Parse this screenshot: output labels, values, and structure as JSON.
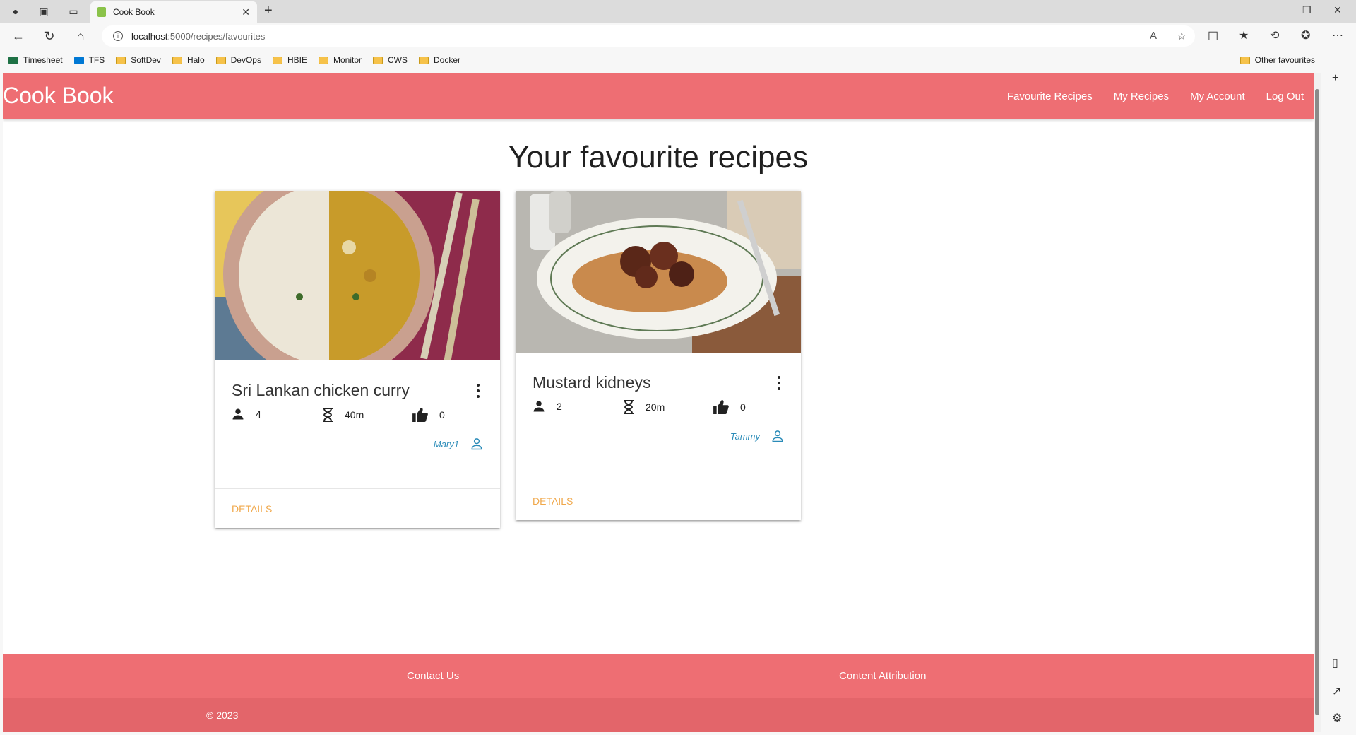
{
  "browser": {
    "tab_title": "Cook Book",
    "url_host": "localhost",
    "url_path": ":5000/recipes/favourites",
    "bookmarks": [
      "Timesheet",
      "TFS",
      "SoftDev",
      "Halo",
      "DevOps",
      "HBIE",
      "Monitor",
      "CWS",
      "Docker"
    ],
    "other_favourites": "Other favourites"
  },
  "app": {
    "brand": "Cook Book",
    "nav": [
      "Favourite Recipes",
      "My Recipes",
      "My Account",
      "Log Out"
    ],
    "page_title": "Your favourite recipes",
    "details_label": "DETAILS"
  },
  "recipes": [
    {
      "title": "Sri Lankan chicken curry",
      "serves": "4",
      "time": "40m",
      "likes": "0",
      "author": "Mary1"
    },
    {
      "title": "Mustard kidneys",
      "serves": "2",
      "time": "20m",
      "likes": "0",
      "author": "Tammy"
    }
  ],
  "footer": {
    "contact": "Contact Us",
    "attribution": "Content Attribution",
    "copyright": "© 2023"
  },
  "colors": {
    "header": "#ee6e73",
    "details_link": "#f0a84b",
    "author_link": "#2a8bb8"
  }
}
